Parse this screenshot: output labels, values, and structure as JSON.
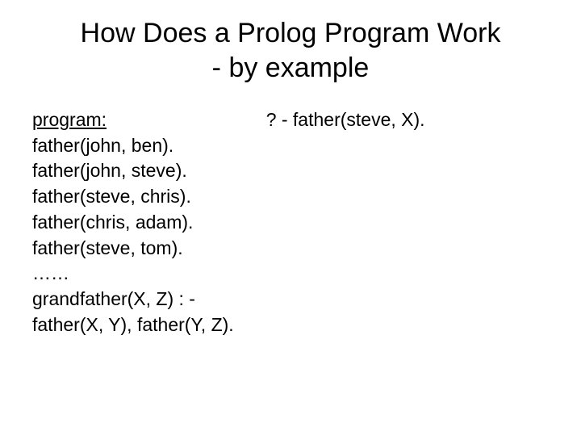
{
  "title_line1": "How Does a Prolog Program Work",
  "title_line2": "- by example",
  "left": {
    "heading": "program:",
    "facts": [
      "father(john, ben).",
      "father(john, steve).",
      "father(steve, chris).",
      "father(chris, adam).",
      "father(steve, tom).",
      "……"
    ],
    "rule_head": "grandfather(X, Z) : -",
    "rule_body": " father(X, Y), father(Y, Z)."
  },
  "right": {
    "query": "? - father(steve, X)."
  }
}
